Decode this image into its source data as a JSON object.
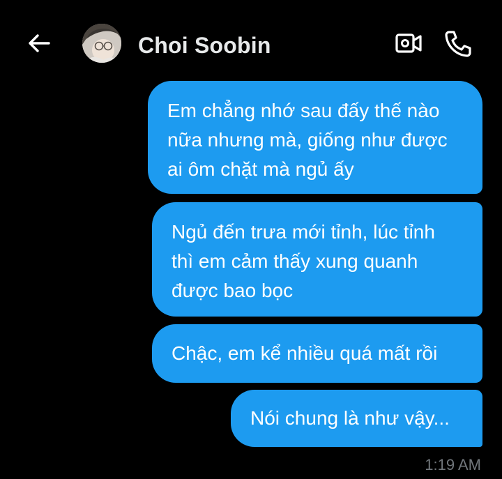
{
  "header": {
    "contact_name": "Choi Soobin",
    "back_icon": "arrow-left-icon",
    "video_icon": "video-camera-icon",
    "phone_icon": "phone-icon"
  },
  "messages": [
    {
      "direction": "outgoing",
      "text": "Em chẳng nhớ sau đấy thế nào\nnữa nhưng mà, giống như được\nai ôm chặt mà ngủ ấy"
    },
    {
      "direction": "outgoing",
      "text": "Ngủ đến trưa mới tỉnh, lúc tỉnh\nthì em cảm thấy xung quanh\nđược bao bọc"
    },
    {
      "direction": "outgoing",
      "text": "Chậc, em kể nhiều quá mất rồi"
    },
    {
      "direction": "outgoing",
      "text": "Nói chung là như vậy..."
    }
  ],
  "timestamp": "1:19 AM",
  "colors": {
    "background": "#000000",
    "bubble": "#1d9bf0",
    "name_text": "#e7e9ea",
    "timestamp_text": "#71767b"
  }
}
